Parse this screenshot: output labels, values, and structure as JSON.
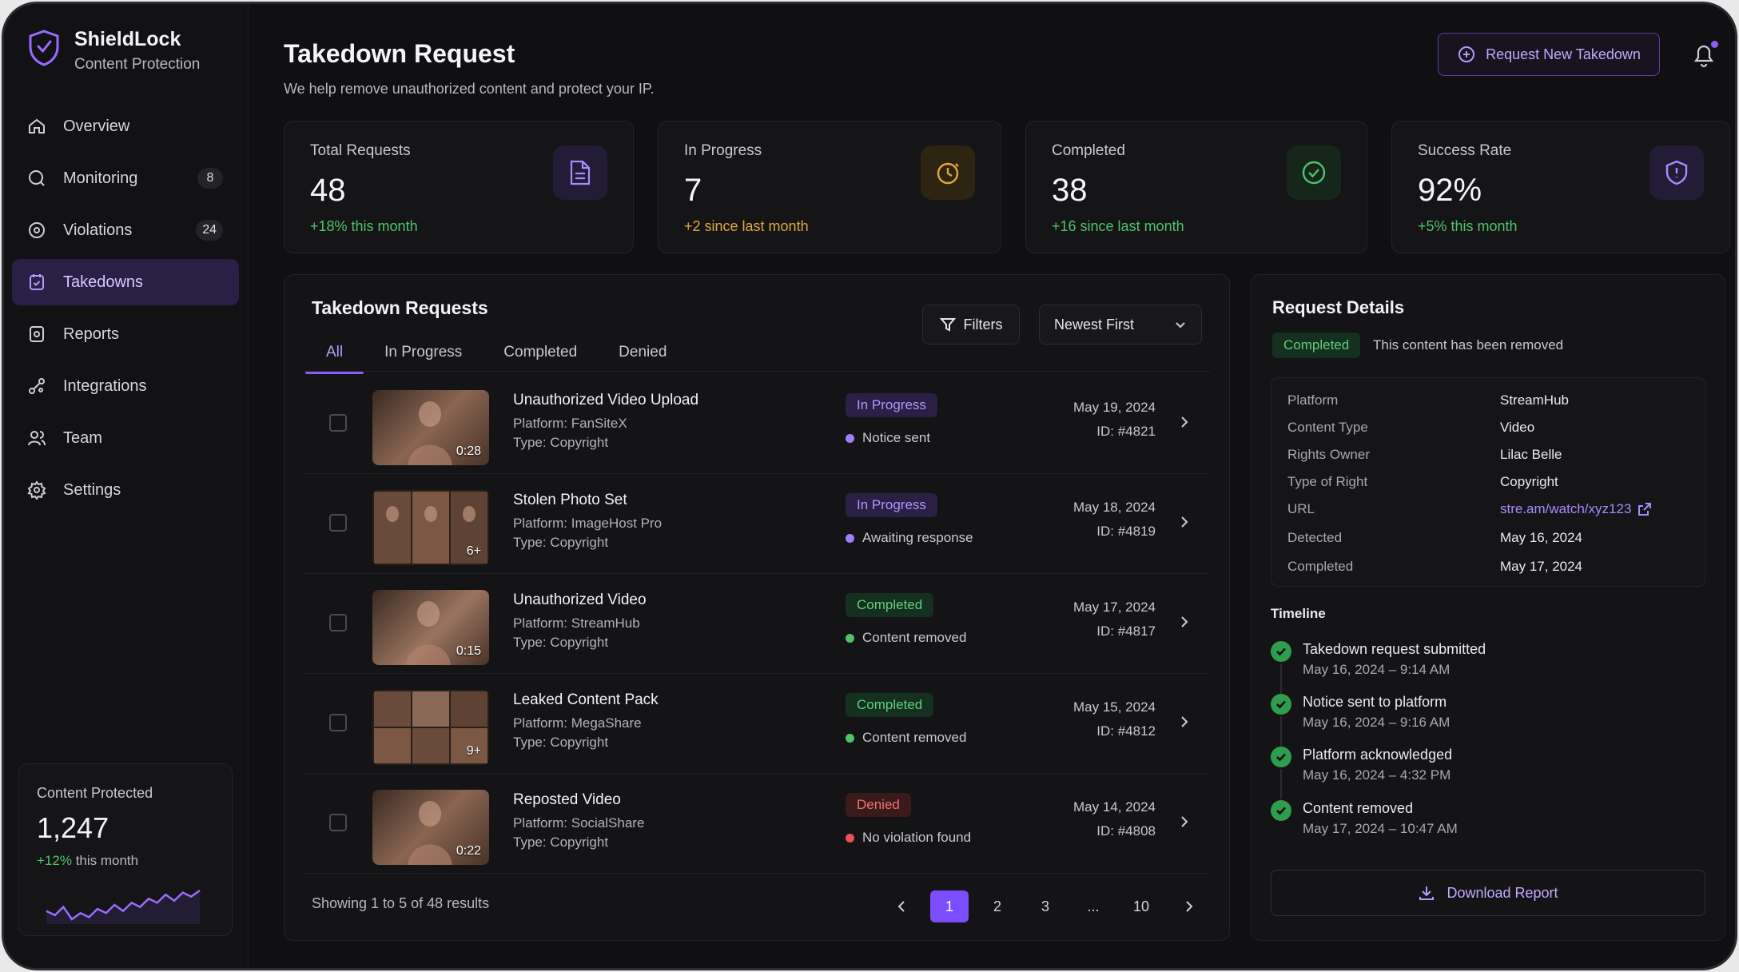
{
  "app": {
    "name": "ShieldLock",
    "subtitle": "Content Protection"
  },
  "sidebar": {
    "items": [
      {
        "label": "Overview",
        "icon": "home-icon"
      },
      {
        "label": "Monitoring",
        "icon": "monitor-icon",
        "badge": "8"
      },
      {
        "label": "Violations",
        "icon": "violation-icon",
        "badge": "24"
      },
      {
        "label": "Takedowns",
        "icon": "takedown-icon",
        "active": true
      },
      {
        "label": "Reports",
        "icon": "reports-icon"
      },
      {
        "label": "Integrations",
        "icon": "integrations-icon"
      },
      {
        "label": "Team",
        "icon": "team-icon"
      },
      {
        "label": "Settings",
        "icon": "gear-icon"
      }
    ],
    "protected": {
      "label": "Content Protected",
      "value": "1,247",
      "change": "+12%",
      "change_suffix": "this month",
      "spark": [
        10,
        8,
        12,
        6,
        9,
        7,
        11,
        9,
        13,
        10,
        14,
        12,
        16,
        14,
        18,
        15,
        19,
        17,
        20
      ]
    }
  },
  "header": {
    "title": "Takedown Request",
    "subtitle": "We help remove unauthorized content and protect your IP.",
    "new_button": "Request New Takedown"
  },
  "stats": [
    {
      "label": "Total Requests",
      "value": "48",
      "change": "+18% this month",
      "color": "#4fc36a",
      "icon": "document-icon"
    },
    {
      "label": "In Progress",
      "value": "7",
      "change": "+2 since last month",
      "color": "#e0a83a",
      "icon": "clock-icon"
    },
    {
      "label": "Completed",
      "value": "38",
      "change": "+16 since last month",
      "color": "#4fc36a",
      "icon": "check-circle-icon"
    },
    {
      "label": "Success Rate",
      "value": "92%",
      "change": "+5% this month",
      "color": "#4fc36a",
      "icon": "shield-icon"
    }
  ],
  "requests": {
    "title": "Takedown Requests",
    "tabs": [
      "All",
      "In Progress",
      "Completed",
      "Denied"
    ],
    "filters_label": "Filters",
    "sort_label": "Newest First",
    "rows": [
      {
        "title": "Unauthorized Video Upload",
        "platform": "Platform: FanSiteX",
        "type": "Type: Copyright",
        "status": "In Progress",
        "note": "Notice sent",
        "date": "May 19, 2024",
        "id": "ID: #4821",
        "thumb": "0:28"
      },
      {
        "title": "Stolen Photo Set",
        "platform": "Platform: ImageHost Pro",
        "type": "Type: Copyright",
        "status": "In Progress",
        "note": "Awaiting response",
        "date": "May 18, 2024",
        "id": "ID: #4819",
        "thumb": "6+"
      },
      {
        "title": "Unauthorized Video",
        "platform": "Platform: StreamHub",
        "type": "Type: Copyright",
        "status": "Completed",
        "note": "Content removed",
        "date": "May 17, 2024",
        "id": "ID: #4817",
        "thumb": "0:15"
      },
      {
        "title": "Leaked Content Pack",
        "platform": "Platform: MegaShare",
        "type": "Type: Copyright",
        "status": "Completed",
        "note": "Content removed",
        "date": "May 15, 2024",
        "id": "ID: #4812",
        "thumb": "9+"
      },
      {
        "title": "Reposted Video",
        "platform": "Platform: SocialShare",
        "type": "Type: Copyright",
        "status": "Denied",
        "note": "No violation found",
        "date": "May 14, 2024",
        "id": "ID: #4808",
        "thumb": "0:22"
      }
    ],
    "showing": "Showing 1 to 5 of 48 results",
    "pages": [
      "1",
      "2",
      "3",
      "...",
      "10"
    ]
  },
  "details": {
    "title": "Request Details",
    "status": "Completed",
    "status_note": "This content has been removed",
    "fields": [
      {
        "label": "Platform",
        "value": "StreamHub"
      },
      {
        "label": "Content Type",
        "value": "Video"
      },
      {
        "label": "Rights Owner",
        "value": "Lilac Belle"
      },
      {
        "label": "Type of Right",
        "value": "Copyright"
      },
      {
        "label": "URL",
        "value": "stre.am/watch/xyz123"
      },
      {
        "label": "Detected",
        "value": "May 16, 2024"
      },
      {
        "label": "Completed",
        "value": "May 17, 2024"
      }
    ],
    "timeline_title": "Timeline",
    "timeline": [
      {
        "event": "Takedown request submitted",
        "time": "May 16, 2024 – 9:14 AM"
      },
      {
        "event": "Notice sent to platform",
        "time": "May 16, 2024 – 9:16 AM"
      },
      {
        "event": "Platform acknowledged",
        "time": "May 16, 2024 – 4:32 PM"
      },
      {
        "event": "Content removed",
        "time": "May 17, 2024 – 10:47 AM"
      }
    ],
    "download_label": "Download Report"
  },
  "colors": {
    "accent": "#8b5cf6",
    "success": "#4fc36a",
    "warning": "#e0a83a",
    "danger": "#f07070"
  }
}
